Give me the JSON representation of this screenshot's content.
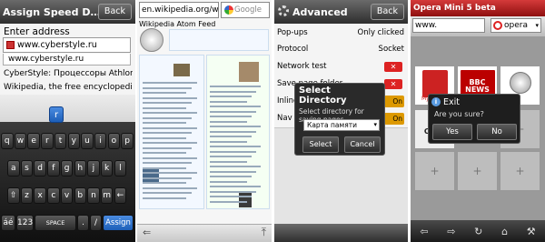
{
  "panel1": {
    "title": "Assign Speed D…",
    "back_label": "Back",
    "enter_address_label": "Enter address",
    "address_value": "www.cyberstyle.ru",
    "suggestion": "www.cyberstyle.ru",
    "history_item_1": "CyberStyle: Процессоры Athlon II X…",
    "history_item_2": "Wikipedia, the free encyclopedia",
    "popup_key": "r",
    "keyboard": {
      "row1": [
        "q",
        "w",
        "e",
        "r",
        "t",
        "y",
        "u",
        "i",
        "o",
        "p"
      ],
      "row2": [
        "a",
        "s",
        "d",
        "f",
        "g",
        "h",
        "j",
        "k",
        "l"
      ],
      "row3": [
        "⇧",
        "z",
        "x",
        "c",
        "v",
        "b",
        "n",
        "m",
        "←"
      ],
      "row4_1": "áé",
      "row4_2": "123",
      "row4_3": "SPACE",
      "row4_4": ".",
      "row4_5": "/",
      "assign": "Assign"
    }
  },
  "panel2": {
    "url": "en.wikipedia.org/wi",
    "search_placeholder": "Google",
    "feed_label": "Wikipedia Atom Feed"
  },
  "panel3": {
    "title": "Advanced",
    "back_label": "Back",
    "rows": [
      {
        "label": "Pop-ups",
        "value": "Only clicked"
      },
      {
        "label": "Protocol",
        "value": "Socket"
      },
      {
        "label": "Network test",
        "value": ""
      },
      {
        "label": "Save page folder",
        "value": ""
      },
      {
        "label": "Inline",
        "value": "On"
      },
      {
        "label": "Nav",
        "value": "On"
      }
    ],
    "dialog": {
      "title": "Select Directory",
      "description": "Select directory for saving pages.",
      "select_value": "Карта памяти",
      "select_button": "Select",
      "cancel_button": "Cancel"
    }
  },
  "panel4": {
    "title": "Opera Mini 5 beta",
    "url": "www.",
    "search_engine": "opera",
    "tiles": {
      "my_opera": "My Opera",
      "bbc": "BBC NEWS",
      "cyberstyle": "CYBE"
    },
    "exit_dialog": {
      "title": "Exit",
      "question": "Are you sure?",
      "yes": "Yes",
      "no": "No"
    }
  }
}
